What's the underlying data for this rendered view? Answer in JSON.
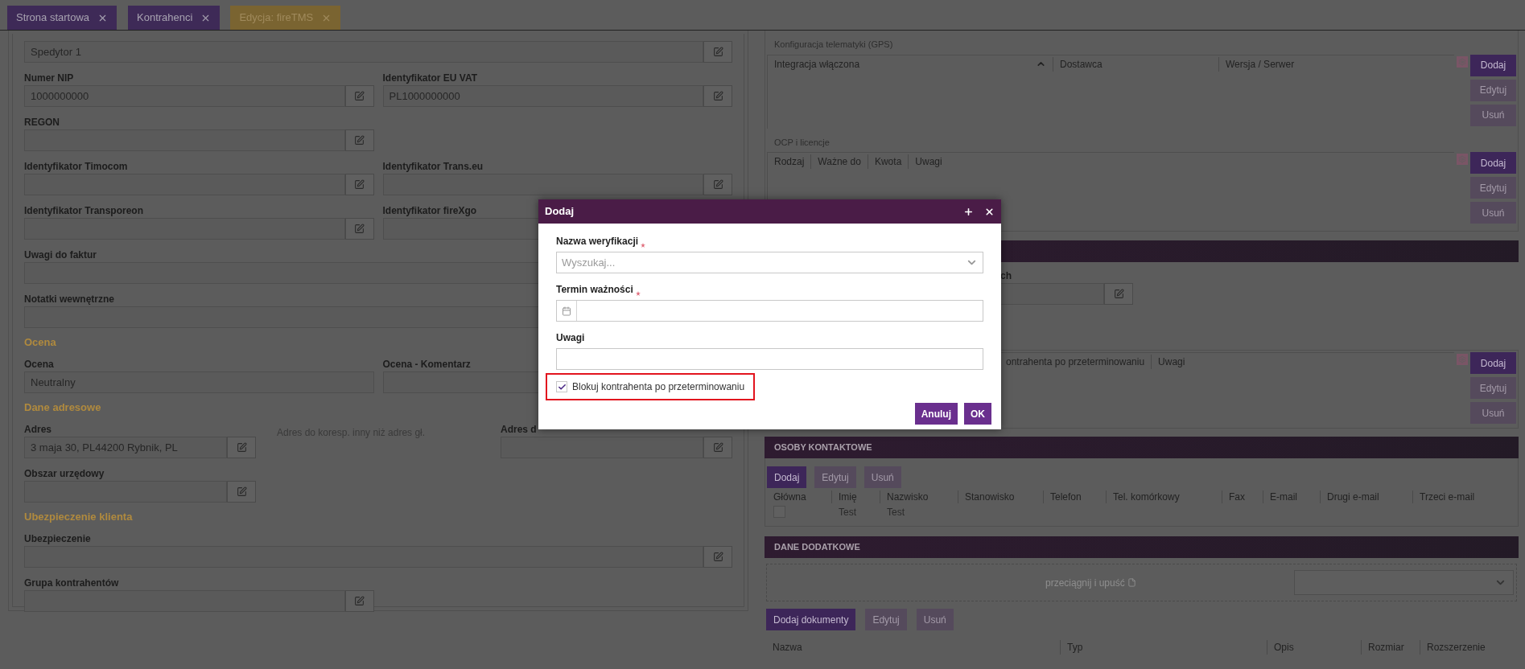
{
  "tabs": [
    {
      "label": "Strona startowa",
      "selected": false
    },
    {
      "label": "Kontrahenci",
      "selected": false
    },
    {
      "label": "Edycja: fireTMS",
      "selected": true
    }
  ],
  "left_form": {
    "rows": [
      {
        "kind": "full",
        "fields": [
          {
            "value": "Spedytor 1",
            "edit": true
          }
        ]
      },
      {
        "kind": "pair",
        "fields": [
          {
            "label": "Numer NIP",
            "value": "1000000000",
            "edit": true
          },
          {
            "label": "Identyfikator EU VAT",
            "value": "PL1000000000",
            "edit": true
          }
        ]
      },
      {
        "kind": "pair",
        "fields": [
          {
            "label": "REGON",
            "edit": true
          }
        ]
      },
      {
        "kind": "pair",
        "fields": [
          {
            "label": "Identyfikator Timocom",
            "edit": true
          },
          {
            "label": "Identyfikator Trans.eu",
            "edit": true
          }
        ]
      },
      {
        "kind": "pair",
        "fields": [
          {
            "label": "Identyfikator Transporeon",
            "edit": true
          },
          {
            "label": "Identyfikator fireXgo"
          }
        ]
      },
      {
        "kind": "full",
        "fields": [
          {
            "label": "Uwagi do faktur"
          }
        ]
      },
      {
        "kind": "full",
        "fields": [
          {
            "label": "Notatki wewnętrzne"
          }
        ]
      },
      {
        "kind": "section",
        "title": "Ocena"
      },
      {
        "kind": "pair",
        "fields": [
          {
            "label": "Ocena",
            "value": "Neutralny",
            "edit": false
          },
          {
            "label": "Ocena - Komentarz"
          }
        ]
      },
      {
        "kind": "section",
        "title": "Dane adresowe"
      },
      {
        "kind": "address",
        "note": "Adres do koresp. inny niż adres gł.",
        "fields": [
          {
            "label": "Adres",
            "value": "3 maja 30, PL44200 Rybnik, PL",
            "edit": true
          },
          {
            "label": "Adres d",
            "edit": true
          }
        ]
      },
      {
        "kind": "address",
        "fields": [
          {
            "label": "Obszar urzędowy",
            "edit": true
          }
        ]
      },
      {
        "kind": "section",
        "title": "Ubezpieczenie klienta"
      },
      {
        "kind": "full",
        "fields": [
          {
            "label": "Ubezpieczenie",
            "edit": true
          }
        ]
      },
      {
        "kind": "pair",
        "fields": [
          {
            "label": "Grupa kontrahentów",
            "edit": true
          }
        ]
      }
    ]
  },
  "right_panel": {
    "tables": [
      {
        "title": "Konfiguracja telematyki (GPS)",
        "columns": [
          {
            "label": "Integracja włączona",
            "sorted": true
          },
          {
            "label": "Dostawca",
            "sorted": false
          },
          {
            "label": "Wersja / Serwer",
            "sorted": false
          }
        ],
        "buttons": [
          {
            "label": "Dodaj",
            "disabled": false
          },
          {
            "label": "Edytuj",
            "disabled": true
          },
          {
            "label": "Usuń",
            "disabled": true
          }
        ]
      },
      {
        "title": "OCP i licencje",
        "columns": [
          {
            "label": "Rodzaj",
            "sorted": false
          },
          {
            "label": "Ważne do",
            "sorted": false
          },
          {
            "label": "Kwota",
            "sorted": false
          },
          {
            "label": "Uwagi",
            "sorted": false
          }
        ],
        "buttons": [
          {
            "label": "Dodaj",
            "disabled": false
          },
          {
            "label": "Edytuj",
            "disabled": true
          },
          {
            "label": "Usuń",
            "disabled": true
          }
        ]
      }
    ],
    "verification": {
      "field_label": "ch",
      "columns": [
        {
          "label": "ontrahenta po przeterminowaniu",
          "sorted": false
        },
        {
          "label": "Uwagi",
          "sorted": false
        }
      ],
      "buttons": [
        {
          "label": "Dodaj",
          "disabled": false
        },
        {
          "label": "Edytuj",
          "disabled": true
        },
        {
          "label": "Usuń",
          "disabled": true
        }
      ]
    },
    "contacts": {
      "title": "OSOBY KONTAKTOWE",
      "buttons": [
        {
          "label": "Dodaj",
          "disabled": false
        },
        {
          "label": "Edytuj",
          "disabled": true
        },
        {
          "label": "Usuń",
          "disabled": true
        }
      ],
      "columns": [
        "Główna",
        "Imię",
        "Nazwisko",
        "Stanowisko",
        "Telefon",
        "Tel. komórkowy",
        "Fax",
        "E-mail",
        "Drugi e-mail",
        "Trzeci e-mail"
      ],
      "rows": [
        {
          "checked": false,
          "cells": [
            "",
            "Test",
            "Test"
          ]
        }
      ]
    },
    "extra": {
      "title": "DANE DODATKOWE",
      "drop_hint": "przeciągnij i upuść",
      "buttons": [
        {
          "label": "Dodaj dokumenty",
          "disabled": false
        },
        {
          "label": "Edytuj",
          "disabled": true
        },
        {
          "label": "Usuń",
          "disabled": true
        }
      ],
      "columns": [
        "Nazwa",
        "Typ",
        "Opis",
        "Rozmiar",
        "Rozszerzenie"
      ]
    }
  },
  "dialog": {
    "title": "Dodaj",
    "fields": [
      {
        "kind": "select",
        "label": "Nazwa weryfikacji",
        "required": true,
        "placeholder": "Wyszukaj..."
      },
      {
        "kind": "date",
        "label": "Termin ważności",
        "required": true
      },
      {
        "kind": "text",
        "label": "Uwagi",
        "required": false
      }
    ],
    "checkbox": {
      "label": "Blokuj kontrahenta po przeterminowaniu",
      "checked": true,
      "highlighted": true
    },
    "buttons": [
      {
        "label": "Anuluj"
      },
      {
        "label": "OK"
      }
    ]
  }
}
